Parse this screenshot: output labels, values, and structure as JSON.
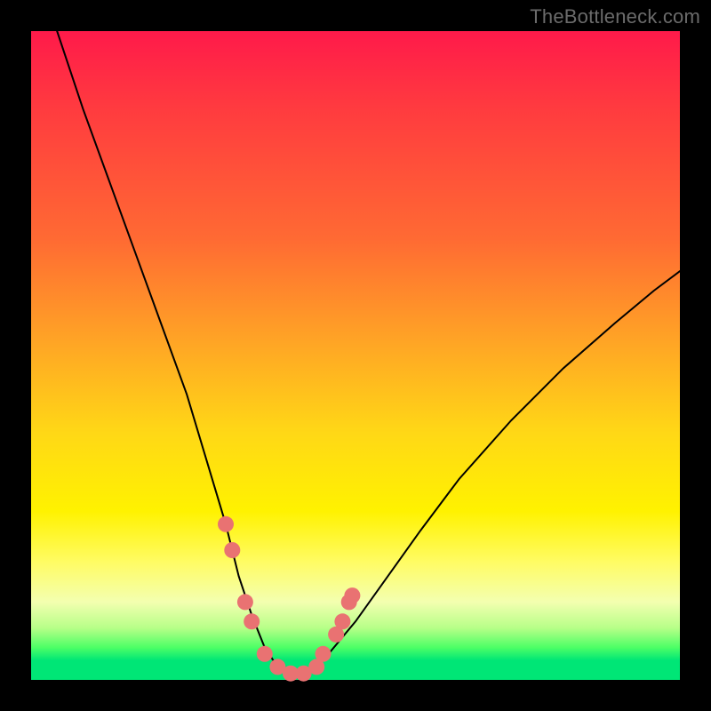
{
  "watermark": "TheBottleneck.com",
  "chart_data": {
    "type": "line",
    "title": "",
    "xlabel": "",
    "ylabel": "",
    "xlim": [
      0,
      100
    ],
    "ylim": [
      0,
      100
    ],
    "grid": false,
    "legend": false,
    "annotations": [],
    "series": [
      {
        "name": "bottleneck-curve",
        "x": [
          4,
          8,
          12,
          16,
          20,
          24,
          27,
          30,
          32,
          34,
          36,
          38,
          40,
          42,
          45,
          50,
          55,
          60,
          66,
          74,
          82,
          90,
          96,
          100
        ],
        "y": [
          100,
          88,
          77,
          66,
          55,
          44,
          34,
          24,
          16,
          10,
          5,
          2,
          1,
          1,
          3,
          9,
          16,
          23,
          31,
          40,
          48,
          55,
          60,
          63
        ],
        "stroke": "#000000",
        "stroke_width": 2
      }
    ],
    "markers": {
      "name": "highlight-dots",
      "color": "#e97272",
      "radius_px": 9,
      "points_xy": [
        [
          30,
          24
        ],
        [
          31,
          20
        ],
        [
          33,
          12
        ],
        [
          34,
          9
        ],
        [
          36,
          4
        ],
        [
          38,
          2
        ],
        [
          40,
          1
        ],
        [
          42,
          1
        ],
        [
          44,
          2
        ],
        [
          45,
          4
        ],
        [
          47,
          7
        ],
        [
          48,
          9
        ],
        [
          49,
          12
        ],
        [
          49.5,
          13
        ]
      ]
    }
  }
}
